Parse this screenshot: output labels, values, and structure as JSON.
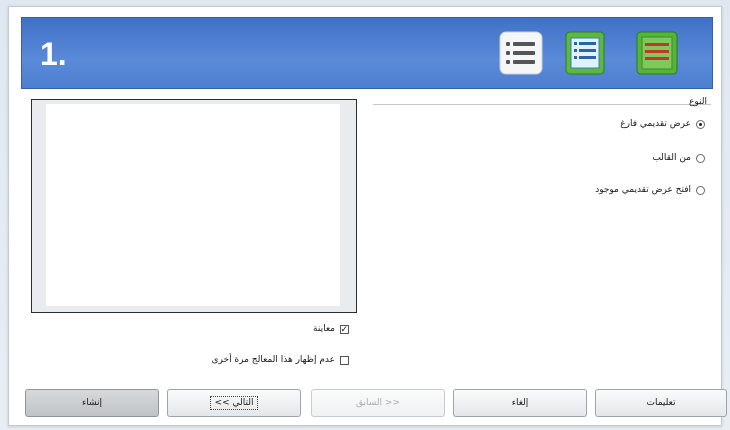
{
  "header": {
    "step": "1.",
    "icons": [
      "bulleted-list-icon",
      "outline-icon",
      "notes-icon"
    ]
  },
  "type_group": {
    "label": "النوع",
    "options": [
      {
        "label": "عرض تقديمي فارغ",
        "selected": true
      },
      {
        "label": "من القالب",
        "selected": false
      },
      {
        "label": "افتح عرض تقديمي موجود",
        "selected": false
      }
    ]
  },
  "options": {
    "preview_label": "معاينة",
    "preview_checked": true,
    "dont_show_label": "عدم إظهار هذا المعالج مرة أخرى",
    "dont_show_checked": false
  },
  "buttons": {
    "help": "تعليمات",
    "cancel": "إلغاء",
    "back": "<< السابق",
    "next": "التالي >>",
    "finish": "إنشاء"
  },
  "colors": {
    "header_blue": "#4a7bd0",
    "icon_green": "#4cae2e"
  }
}
